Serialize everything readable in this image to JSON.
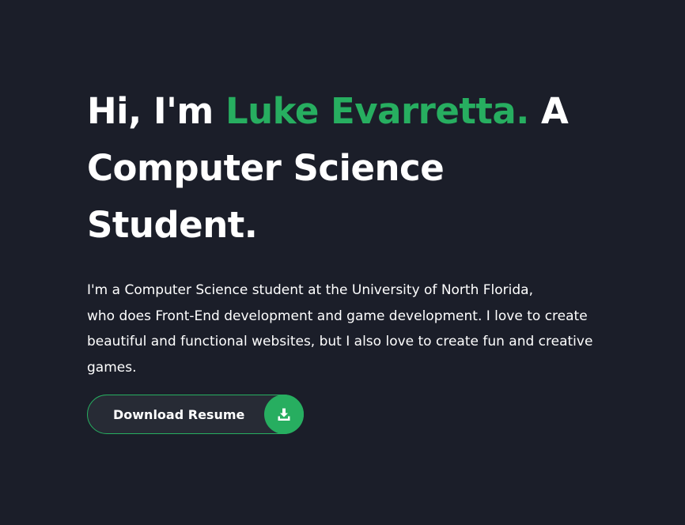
{
  "hero": {
    "greeting": "Hi, I'm ",
    "name": "Luke Evarretta.",
    "tagline_1": " A",
    "tagline_2": "Computer Science",
    "tagline_3": "Student.",
    "intro_lines": [
      "I'm a Computer Science student at the University of North Florida,",
      "who does Front-End development and game development. I love to create",
      "beautiful and functional websites, but I also love to create fun and creative",
      "games."
    ]
  },
  "cta": {
    "label": "Download Resume",
    "icon": "download-icon"
  },
  "colors": {
    "background": "#1b1e29",
    "accent": "#27ae60",
    "text": "#ffffff",
    "button_bg": "#272b35"
  }
}
